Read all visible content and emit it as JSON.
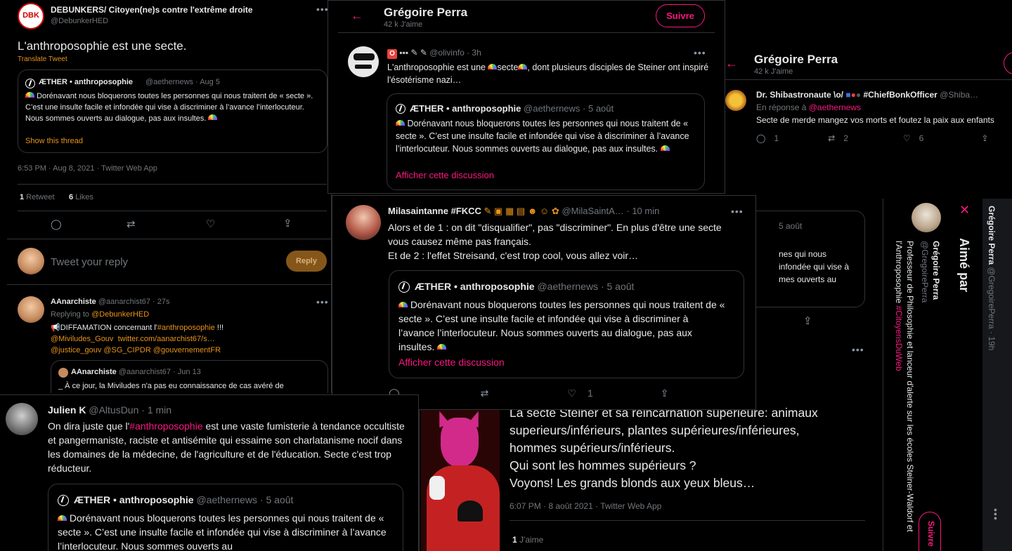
{
  "p1": {
    "author": "DEBUNKERS/ Citoyen(ne)s contre l'extrême droite",
    "handle": "@DebunkerHED",
    "logo_text": "DBK",
    "text": "L'anthroposophie est une secte.",
    "translate": "Translate Tweet",
    "quote": {
      "author": "ÆTHER • anthroposophie",
      "handle_time": "@aethernews · Aug 5",
      "text": "Dorénavant nous bloquerons toutes les personnes qui nous traitent de « secte ». C’est une insulte facile et infondée qui vise à discriminer à l’avance l’interlocuteur. Nous sommes ouverts au dialogue, pas aux insultes.",
      "show_thread": "Show this thread"
    },
    "meta": "6:53 PM · Aug 8, 2021 · Twitter Web App",
    "retweets_count": "1",
    "retweets_label": "Retweet",
    "likes_count": "6",
    "likes_label": "Likes",
    "reply_placeholder": "Tweet your reply",
    "reply_button": "Reply",
    "reply": {
      "author": "AAnarchiste",
      "handle_time": "@aanarchist67 · 27s",
      "replying_prefix": "Replying to",
      "replying_to": "@DebunkerHED",
      "line1_prefix": "📢DIFFAMATION concernant l'",
      "line1_tag": "#anthroposophie",
      "line1_suffix": " !!!",
      "line2_a": "@Miviludes_Gouv",
      "line2_b": "twitter.com/aanarchist67/s…",
      "line3_a": "@justice_gouv",
      "line3_b": "@SG_CIPDR",
      "line3_c": "@gouvernementFR",
      "quote_author": "AAnarchiste",
      "quote_handle_time": "@aanarchist67 · Jun 13",
      "quote_text": "_ À ce jour, la Miviludes n'a pas eu connaissance de cas avéré de"
    }
  },
  "p2": {
    "title": "Grégoire Perra",
    "subtitle": "42 k J'aime",
    "follow": "Suivre",
    "author_badge": "O",
    "author_time": "@olivinfo · 3h",
    "text_a": "L'anthroposophie est une ",
    "text_b": "secte",
    "text_c": ", dont plusieurs disciples de Steiner ont inspiré l'ésotérisme nazi…",
    "quote_author": "ÆTHER • anthroposophie",
    "quote_handle_time": "@aethernews · 5 août",
    "quote_text": "Dorénavant nous bloquerons toutes les personnes qui nous traitent de « secte ». C’est une insulte facile et infondée qui vise à discriminer à l’avance l’interlocuteur. Nous sommes ouverts au dialogue, pas aux insultes.",
    "quote_link": "Afficher cette discussion"
  },
  "p3": {
    "title": "Grégoire Perra",
    "subtitle": "42 k J'aime",
    "author": "Dr. Shibastronaute \\o/",
    "author_tag": "#ChiefBonkOfficer",
    "author_handle": "@Shiba…",
    "reply_prefix": "En réponse à",
    "reply_to": "@aethernews",
    "text": "Secte de merde mangez vos morts et foutez la paix aux enfants",
    "replies": "1",
    "retweets": "2",
    "likes": "6"
  },
  "p4": {
    "author": "Milasaintanne #FKCC",
    "handle_time": "@MilaSaintA… · 10 min",
    "text1": "Alors et de 1 : on dit \"disqualifier\", pas \"discriminer\". En plus d'être une secte vous causez même pas français.",
    "text2": "Et de 2 : l'effet Streisand, c'est trop cool, vous allez voir…",
    "quote_author": "ÆTHER • anthroposophie",
    "quote_handle_time": "@aethernews · 5 août",
    "quote_text": "Dorénavant nous bloquerons toutes les personnes qui nous traitent de « secte ». C’est une insulte facile et infondée qui vise à discriminer à l’avance l’interlocuteur. Nous sommes ouverts au dialogue, pas aux insultes.",
    "quote_link": "Afficher cette discussion",
    "likes": "1"
  },
  "p5": {
    "author": "Julien K",
    "handle_time": "@AltusDun · 1 min",
    "text_a": "On dira juste que l'",
    "text_tag": "#anthroposophie",
    "text_b": " est une vaste fumisterie à tendance occultiste et pangermaniste, raciste et antisémite qui essaime son charlatanisme nocif dans les domaines de la médecine, de l'agriculture et de l'éducation. Secte c'est trop réducteur.",
    "quote_author": "ÆTHER • anthroposophie",
    "quote_handle_time": "@aethernews · 5 août",
    "quote_text": "Dorénavant nous bloquerons toutes les personnes qui nous traitent de « secte ». C’est une insulte facile et infondée qui vise à discriminer à l’avance l’interlocuteur. Nous sommes ouverts au"
  },
  "p6": {
    "quote_time_fragment": "5 août",
    "quote_fragment_1": "nes qui nous",
    "quote_fragment_2": "infondée qui vise à",
    "quote_fragment_3": "mes ouverts au",
    "main_text_1": "La secte Steiner et sa réincarnation supérieure: animaux",
    "main_text_2": "superieurs/inférieurs, plantes supérieures/inférieures,",
    "main_text_3": "hommes supérieurs/inférieurs.",
    "main_text_4": "Qui sont les hommes supérieurs ?",
    "main_text_5": "Voyons! Les grands blonds aux yeux bleus…",
    "meta": "6:07 PM · 8 août 2021 · Twitter Web App",
    "likes_count": "1",
    "likes_label": "J'aime"
  },
  "p7": {
    "title": "Aimé par",
    "name": "Grégoire Perra",
    "handle": "@GregoirePerra",
    "bio_a": "Professeur de Philosophie et lanceur d'alerte sur les écoles Steiner-Waldorf et l'Anthroposophie ",
    "bio_tag": "#CitoyensDuWeb",
    "follow": "Suivre"
  },
  "p8": {
    "name": "Grégoire Perra",
    "handle_time": "@GregoirePerra · 19h"
  },
  "colors": {
    "accent": "#f91880",
    "orange": "#e8931b",
    "background": "#000000"
  }
}
